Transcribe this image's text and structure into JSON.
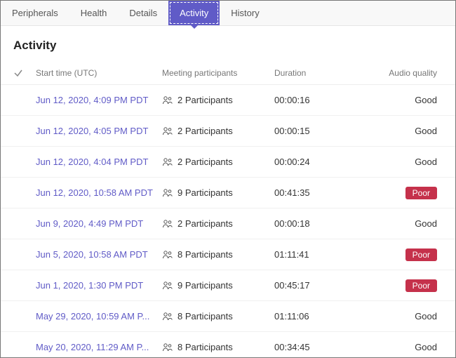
{
  "tabs": [
    {
      "label": "Peripherals",
      "active": false
    },
    {
      "label": "Health",
      "active": false
    },
    {
      "label": "Details",
      "active": false
    },
    {
      "label": "Activity",
      "active": true
    },
    {
      "label": "History",
      "active": false
    }
  ],
  "heading": "Activity",
  "columns": {
    "check": "",
    "start": "Start time (UTC)",
    "participants": "Meeting participants",
    "duration": "Duration",
    "quality": "Audio quality"
  },
  "quality_labels": {
    "good": "Good",
    "poor": "Poor"
  },
  "rows": [
    {
      "time": "Jun 12, 2020, 4:09 PM PDT",
      "count": 2,
      "ptext": "2 Participants",
      "duration": "00:00:16",
      "quality": "good"
    },
    {
      "time": "Jun 12, 2020, 4:05 PM PDT",
      "count": 2,
      "ptext": "2 Participants",
      "duration": "00:00:15",
      "quality": "good"
    },
    {
      "time": "Jun 12, 2020, 4:04 PM PDT",
      "count": 2,
      "ptext": "2 Participants",
      "duration": "00:00:24",
      "quality": "good"
    },
    {
      "time": "Jun 12, 2020, 10:58 AM PDT",
      "count": 9,
      "ptext": "9 Participants",
      "duration": "00:41:35",
      "quality": "poor"
    },
    {
      "time": "Jun 9, 2020, 4:49 PM PDT",
      "count": 2,
      "ptext": "2 Participants",
      "duration": "00:00:18",
      "quality": "good"
    },
    {
      "time": "Jun 5, 2020, 10:58 AM PDT",
      "count": 8,
      "ptext": "8 Participants",
      "duration": "01:11:41",
      "quality": "poor"
    },
    {
      "time": "Jun 1, 2020, 1:30 PM PDT",
      "count": 9,
      "ptext": "9 Participants",
      "duration": "00:45:17",
      "quality": "poor"
    },
    {
      "time": "May 29, 2020, 10:59 AM P...",
      "count": 8,
      "ptext": "8 Participants",
      "duration": "01:11:06",
      "quality": "good"
    },
    {
      "time": "May 20, 2020, 11:29 AM P...",
      "count": 8,
      "ptext": "8 Participants",
      "duration": "00:34:45",
      "quality": "good"
    }
  ]
}
